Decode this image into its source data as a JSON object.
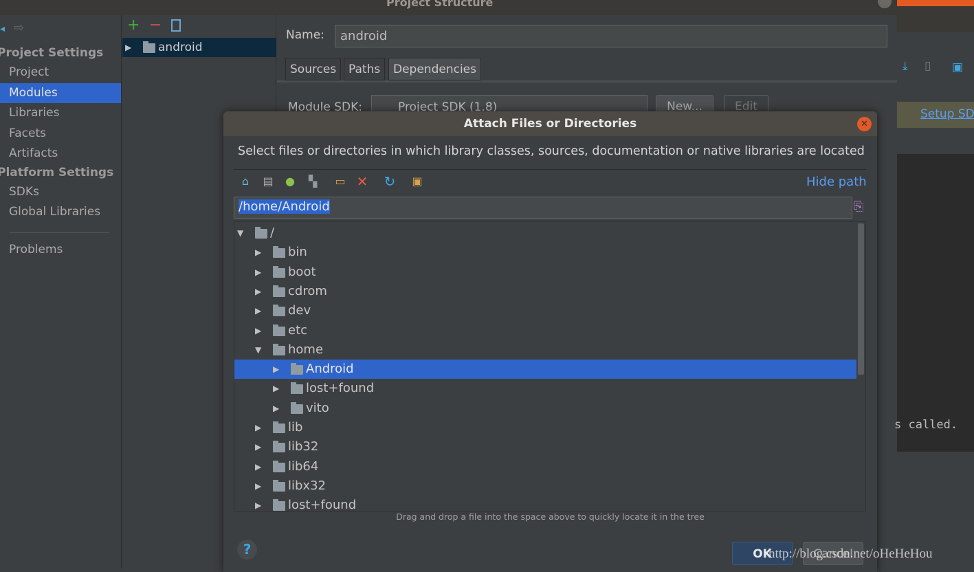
{
  "window": {
    "title": "Project Structure"
  },
  "sidebar": {
    "section1": "Project Settings",
    "items1": [
      "Project",
      "Modules",
      "Libraries",
      "Facets",
      "Artifacts"
    ],
    "section2": "Platform Settings",
    "items2": [
      "SDKs",
      "Global Libraries"
    ],
    "problems": "Problems",
    "selected": "Modules"
  },
  "modules": {
    "items": [
      "android"
    ]
  },
  "main": {
    "name_label": "Name:",
    "name_value": "android",
    "tabs": [
      "Sources",
      "Paths",
      "Dependencies"
    ],
    "active_tab": "Dependencies",
    "sdk_label": "Module SDK:",
    "sdk_value": "Project SDK (1.8)",
    "new_button": "New...",
    "edit_button": "Edit"
  },
  "right": {
    "setup_link": "Setup SD",
    "console_text": "s called."
  },
  "dialog": {
    "title": "Attach Files or Directories",
    "description": "Select files or directories in which library classes, sources, documentation or native libraries are located",
    "hide_path": "Hide path",
    "path_value": "/home/Android",
    "hint": "Drag and drop a file into the space above to quickly locate it in the tree",
    "ok": "OK",
    "cancel": "Cancel",
    "tree": [
      {
        "label": "/",
        "depth": 0,
        "expanded": true
      },
      {
        "label": "bin",
        "depth": 1
      },
      {
        "label": "boot",
        "depth": 1
      },
      {
        "label": "cdrom",
        "depth": 1
      },
      {
        "label": "dev",
        "depth": 1
      },
      {
        "label": "etc",
        "depth": 1
      },
      {
        "label": "home",
        "depth": 1,
        "expanded": true
      },
      {
        "label": "Android",
        "depth": 2,
        "selected": true
      },
      {
        "label": "lost+found",
        "depth": 2
      },
      {
        "label": "vito",
        "depth": 2
      },
      {
        "label": "lib",
        "depth": 1
      },
      {
        "label": "lib32",
        "depth": 1
      },
      {
        "label": "lib64",
        "depth": 1
      },
      {
        "label": "libx32",
        "depth": 1
      },
      {
        "label": "lost+found",
        "depth": 1
      }
    ]
  },
  "watermark": "http://blog.csdn.net/oHeHeHou",
  "colors": {
    "selection": "#2f65ca",
    "link": "#589df6",
    "close": "#e05a2a"
  }
}
